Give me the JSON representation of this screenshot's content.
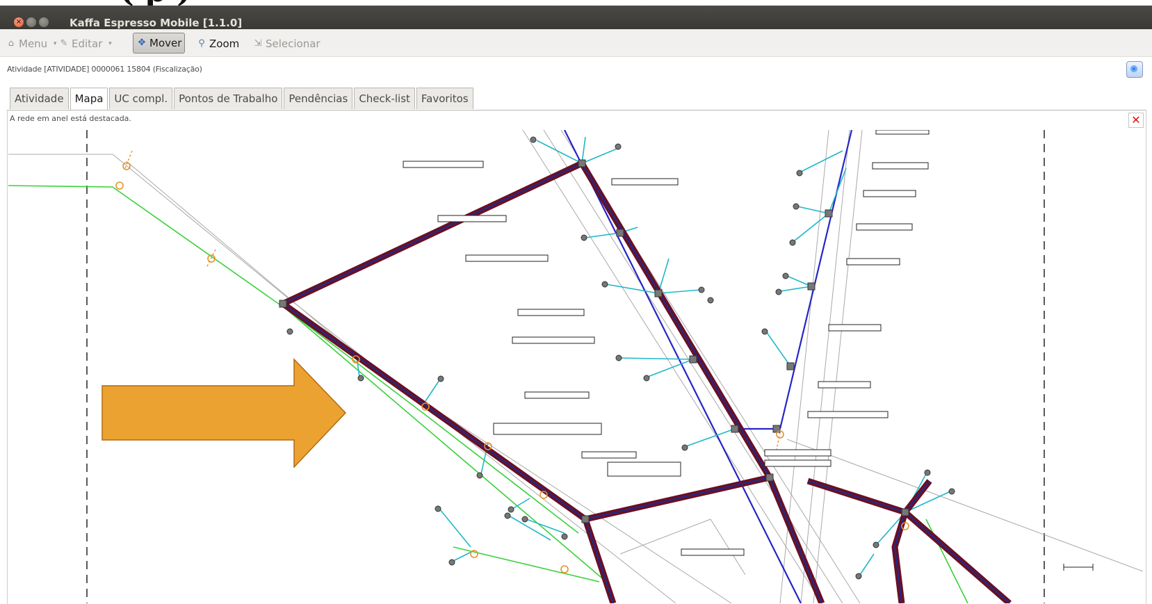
{
  "window": {
    "title": "Kaffa Espresso Mobile [1.1.0]"
  },
  "toolbar": {
    "menu_label": "Menu",
    "editar_label": "Editar",
    "mover_label": "Mover",
    "zoom_label": "Zoom",
    "selecionar_label": "Selecionar"
  },
  "status": {
    "text": "Atividade [ATIVIDADE] 0000061 15804 (Fiscalização)"
  },
  "tabs": [
    {
      "label": "Atividade"
    },
    {
      "label": "Mapa"
    },
    {
      "label": "UC compl."
    },
    {
      "label": "Pontos de Trabalho"
    },
    {
      "label": "Pendências"
    },
    {
      "label": "Check-list"
    },
    {
      "label": "Favoritos"
    }
  ],
  "selected_tab": "Mapa",
  "notice": {
    "text": "A rede em anel está destacada."
  },
  "map": {
    "arrow_color": "#ECA231",
    "ring_color": "#6b0f22",
    "ring_inner_color": "#1f2a8a"
  }
}
